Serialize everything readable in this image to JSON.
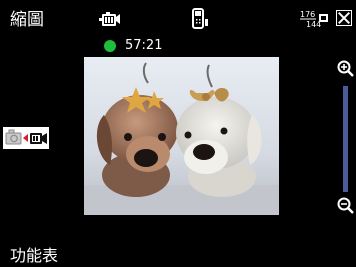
{
  "header": {
    "title": "縮圖",
    "icons": [
      "video-camera-icon",
      "phone-battery-icon",
      "resolution-icon",
      "close-icon"
    ],
    "resolution_label": "176x144"
  },
  "recording": {
    "status_color": "#1fbd3c",
    "time": "57:21"
  },
  "preview": {
    "content": "camera viewfinder image of two plush dog toys"
  },
  "zoom": {
    "icons": [
      "zoom-in-icon",
      "zoom-out-icon"
    ],
    "track_color": "#4c5b9a"
  },
  "mode_switch": {
    "icons": [
      "photo-camera-icon",
      "video-camera-icon"
    ],
    "arrow_color": "#d3202a"
  },
  "softkeys": {
    "left_label": "功能表"
  }
}
